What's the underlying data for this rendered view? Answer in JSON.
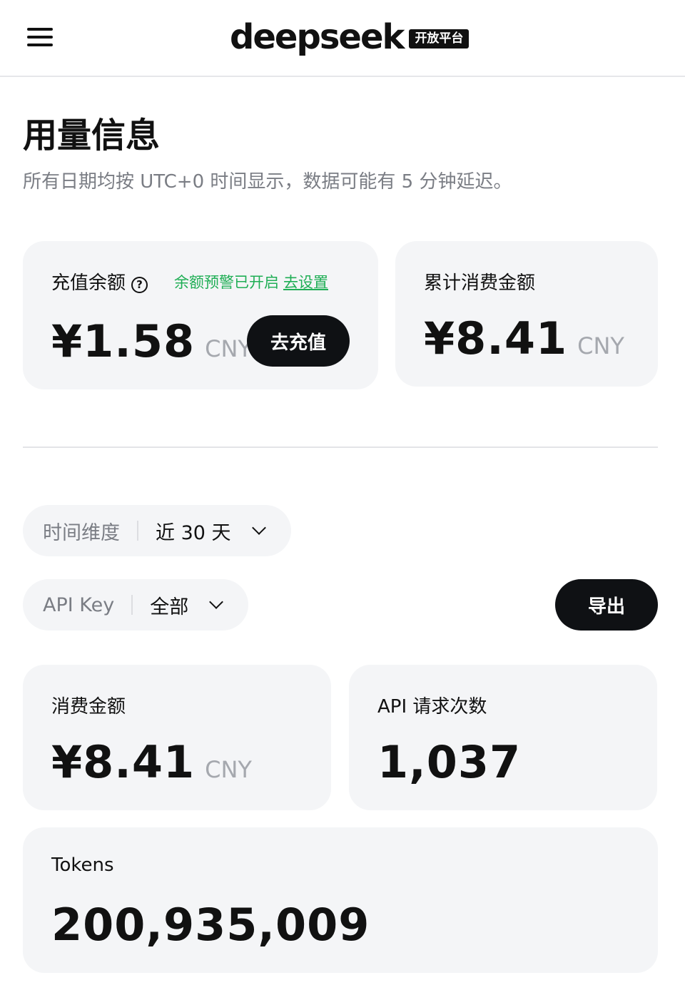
{
  "header": {
    "brand": "deepseek",
    "badge": "开放平台"
  },
  "page": {
    "title": "用量信息",
    "subtitle": "所有日期均按 UTC+0 时间显示，数据可能有 5 分钟延迟。"
  },
  "balance": {
    "label": "充值余额",
    "help_glyph": "?",
    "alert_text": "余额预警已开启",
    "alert_link": "去设置",
    "amount": "¥1.58",
    "unit": "CNY",
    "recharge_label": "去充值"
  },
  "total_spent": {
    "label": "累计消费金额",
    "amount": "¥8.41",
    "unit": "CNY"
  },
  "filters": {
    "time": {
      "label": "时间维度",
      "value": "近 30 天"
    },
    "api_key": {
      "label": "API Key",
      "value": "全部"
    },
    "export_label": "导出"
  },
  "stats": {
    "spend": {
      "label": "消费金额",
      "amount": "¥8.41",
      "unit": "CNY"
    },
    "requests": {
      "label": "API 请求次数",
      "value": "1,037"
    },
    "tokens": {
      "label": "Tokens",
      "value": "200,935,009"
    }
  },
  "colors": {
    "accent_green": "#1fae55",
    "button_dark": "#0f1114",
    "card_bg": "#f4f5f7"
  },
  "icons": {
    "menu": "hamburger-menu-icon",
    "help": "question-circle-icon",
    "dropdown": "chevron-down-icon"
  }
}
